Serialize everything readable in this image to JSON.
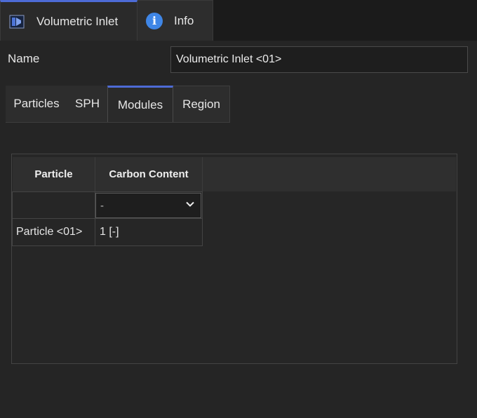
{
  "top_tabs": [
    {
      "label": "Volumetric Inlet",
      "icon": "volumetric-inlet-icon",
      "active": true
    },
    {
      "label": "Info",
      "icon": "info-icon",
      "active": false
    }
  ],
  "name_field": {
    "label": "Name",
    "value": "Volumetric Inlet <01>"
  },
  "sub_tabs": [
    "Particles",
    "SPH",
    "Modules",
    "Region"
  ],
  "active_sub_tab": "Modules",
  "table": {
    "headers": [
      "Particle",
      "Carbon Content"
    ],
    "filter_value": "-",
    "rows": [
      {
        "particle": "Particle <01>",
        "carbon_content": "1 [-]"
      }
    ]
  },
  "colors": {
    "accent": "#4d6bd6",
    "info": "#3f86e6",
    "background": "#252525"
  }
}
